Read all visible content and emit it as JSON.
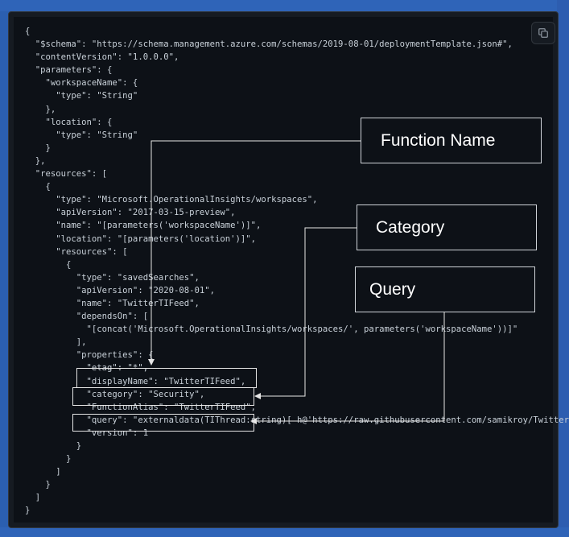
{
  "code_lines": [
    "{",
    "  \"$schema\": \"https://schema.management.azure.com/schemas/2019-08-01/deploymentTemplate.json#\",",
    "  \"contentVersion\": \"1.0.0.0\",",
    "  \"parameters\": {",
    "    \"workspaceName\": {",
    "      \"type\": \"String\"",
    "    },",
    "    \"location\": {",
    "      \"type\": \"String\"",
    "    }",
    "  },",
    "  \"resources\": [",
    "    {",
    "      \"type\": \"Microsoft.OperationalInsights/workspaces\",",
    "      \"apiVersion\": \"2017-03-15-preview\",",
    "      \"name\": \"[parameters('workspaceName')]\",",
    "      \"location\": \"[parameters('location')]\",",
    "      \"resources\": [",
    "        {",
    "          \"type\": \"savedSearches\",",
    "          \"apiVersion\": \"2020-08-01\",",
    "          \"name\": \"TwitterTIFeed\",",
    "          \"dependsOn\": [",
    "            \"[concat('Microsoft.OperationalInsights/workspaces/', parameters('workspaceName'))]\"",
    "          ],",
    "          \"properties\": {",
    "            \"etag\": \"*\",",
    "            \"displayName\": \"TwitterTIFeed\",",
    "            \"category\": \"Security\",",
    "            \"FunctionAlias\": \"TwitterTIFeed\",",
    "            \"query\": \"externaldata(TIThread:string)[ h@'https://raw.githubusercontent.com/samikroy/Twitter-TI",
    "            \"version\": 1",
    "          }",
    "        }",
    "      ]",
    "    }",
    "  ]",
    "}"
  ],
  "callouts": {
    "function_name": "Function Name",
    "category": "Category",
    "query": "Query"
  },
  "icons": {
    "copy": "copy-icon"
  },
  "colors": {
    "background": "#2b5fb0",
    "code_panel": "#0d1117",
    "code_text": "#c9d1d9",
    "annotation": "#e6e6e6"
  }
}
